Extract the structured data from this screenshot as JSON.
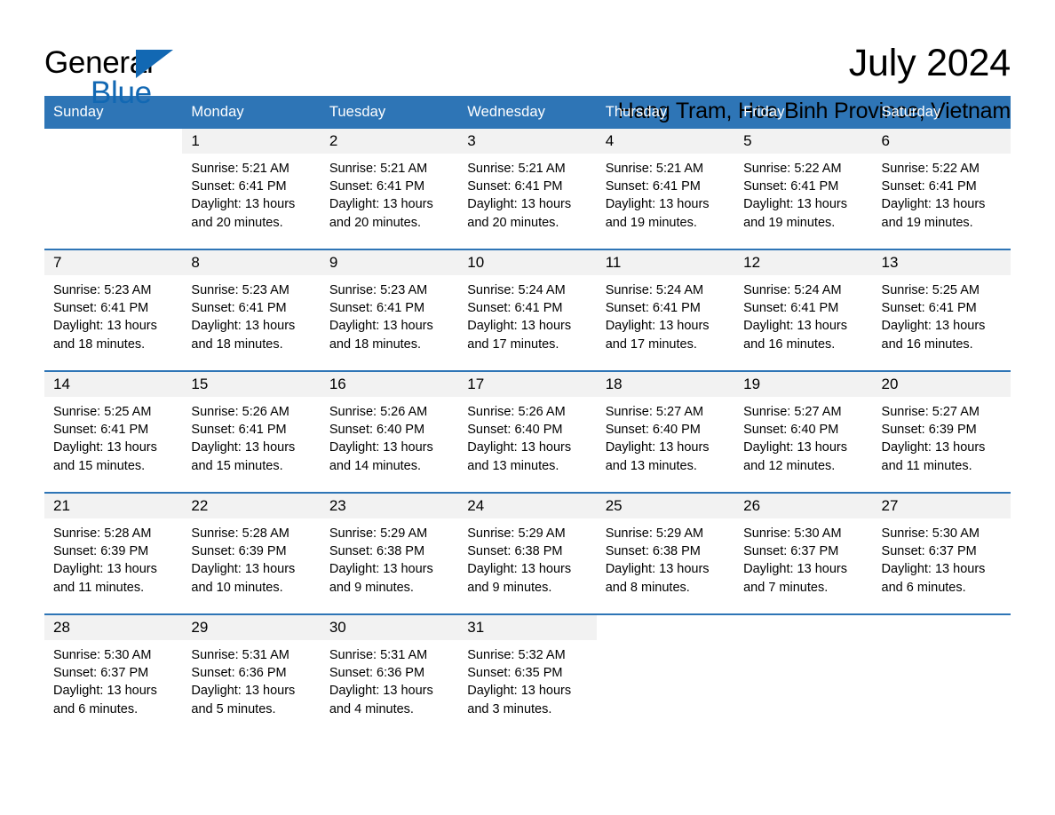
{
  "brand": {
    "name_part1": "General",
    "name_part2": "Blue",
    "logo_icon": "triangle-flag-icon"
  },
  "header": {
    "title": "July 2024",
    "location": "Hang Tram, Hoa Binh Province, Vietnam"
  },
  "colors": {
    "header_blue": "#2e75b6",
    "brand_blue": "#1268b3",
    "day_band_gray": "#f2f2f2",
    "text_black": "#000000"
  },
  "weekdays": [
    "Sunday",
    "Monday",
    "Tuesday",
    "Wednesday",
    "Thursday",
    "Friday",
    "Saturday"
  ],
  "weeks": [
    [
      {
        "day": "",
        "blank": true,
        "sunrise": "",
        "sunset": "",
        "daylight1": "",
        "daylight2": ""
      },
      {
        "day": "1",
        "sunrise": "Sunrise: 5:21 AM",
        "sunset": "Sunset: 6:41 PM",
        "daylight1": "Daylight: 13 hours",
        "daylight2": "and 20 minutes."
      },
      {
        "day": "2",
        "sunrise": "Sunrise: 5:21 AM",
        "sunset": "Sunset: 6:41 PM",
        "daylight1": "Daylight: 13 hours",
        "daylight2": "and 20 minutes."
      },
      {
        "day": "3",
        "sunrise": "Sunrise: 5:21 AM",
        "sunset": "Sunset: 6:41 PM",
        "daylight1": "Daylight: 13 hours",
        "daylight2": "and 20 minutes."
      },
      {
        "day": "4",
        "sunrise": "Sunrise: 5:21 AM",
        "sunset": "Sunset: 6:41 PM",
        "daylight1": "Daylight: 13 hours",
        "daylight2": "and 19 minutes."
      },
      {
        "day": "5",
        "sunrise": "Sunrise: 5:22 AM",
        "sunset": "Sunset: 6:41 PM",
        "daylight1": "Daylight: 13 hours",
        "daylight2": "and 19 minutes."
      },
      {
        "day": "6",
        "sunrise": "Sunrise: 5:22 AM",
        "sunset": "Sunset: 6:41 PM",
        "daylight1": "Daylight: 13 hours",
        "daylight2": "and 19 minutes."
      }
    ],
    [
      {
        "day": "7",
        "sunrise": "Sunrise: 5:23 AM",
        "sunset": "Sunset: 6:41 PM",
        "daylight1": "Daylight: 13 hours",
        "daylight2": "and 18 minutes."
      },
      {
        "day": "8",
        "sunrise": "Sunrise: 5:23 AM",
        "sunset": "Sunset: 6:41 PM",
        "daylight1": "Daylight: 13 hours",
        "daylight2": "and 18 minutes."
      },
      {
        "day": "9",
        "sunrise": "Sunrise: 5:23 AM",
        "sunset": "Sunset: 6:41 PM",
        "daylight1": "Daylight: 13 hours",
        "daylight2": "and 18 minutes."
      },
      {
        "day": "10",
        "sunrise": "Sunrise: 5:24 AM",
        "sunset": "Sunset: 6:41 PM",
        "daylight1": "Daylight: 13 hours",
        "daylight2": "and 17 minutes."
      },
      {
        "day": "11",
        "sunrise": "Sunrise: 5:24 AM",
        "sunset": "Sunset: 6:41 PM",
        "daylight1": "Daylight: 13 hours",
        "daylight2": "and 17 minutes."
      },
      {
        "day": "12",
        "sunrise": "Sunrise: 5:24 AM",
        "sunset": "Sunset: 6:41 PM",
        "daylight1": "Daylight: 13 hours",
        "daylight2": "and 16 minutes."
      },
      {
        "day": "13",
        "sunrise": "Sunrise: 5:25 AM",
        "sunset": "Sunset: 6:41 PM",
        "daylight1": "Daylight: 13 hours",
        "daylight2": "and 16 minutes."
      }
    ],
    [
      {
        "day": "14",
        "sunrise": "Sunrise: 5:25 AM",
        "sunset": "Sunset: 6:41 PM",
        "daylight1": "Daylight: 13 hours",
        "daylight2": "and 15 minutes."
      },
      {
        "day": "15",
        "sunrise": "Sunrise: 5:26 AM",
        "sunset": "Sunset: 6:41 PM",
        "daylight1": "Daylight: 13 hours",
        "daylight2": "and 15 minutes."
      },
      {
        "day": "16",
        "sunrise": "Sunrise: 5:26 AM",
        "sunset": "Sunset: 6:40 PM",
        "daylight1": "Daylight: 13 hours",
        "daylight2": "and 14 minutes."
      },
      {
        "day": "17",
        "sunrise": "Sunrise: 5:26 AM",
        "sunset": "Sunset: 6:40 PM",
        "daylight1": "Daylight: 13 hours",
        "daylight2": "and 13 minutes."
      },
      {
        "day": "18",
        "sunrise": "Sunrise: 5:27 AM",
        "sunset": "Sunset: 6:40 PM",
        "daylight1": "Daylight: 13 hours",
        "daylight2": "and 13 minutes."
      },
      {
        "day": "19",
        "sunrise": "Sunrise: 5:27 AM",
        "sunset": "Sunset: 6:40 PM",
        "daylight1": "Daylight: 13 hours",
        "daylight2": "and 12 minutes."
      },
      {
        "day": "20",
        "sunrise": "Sunrise: 5:27 AM",
        "sunset": "Sunset: 6:39 PM",
        "daylight1": "Daylight: 13 hours",
        "daylight2": "and 11 minutes."
      }
    ],
    [
      {
        "day": "21",
        "sunrise": "Sunrise: 5:28 AM",
        "sunset": "Sunset: 6:39 PM",
        "daylight1": "Daylight: 13 hours",
        "daylight2": "and 11 minutes."
      },
      {
        "day": "22",
        "sunrise": "Sunrise: 5:28 AM",
        "sunset": "Sunset: 6:39 PM",
        "daylight1": "Daylight: 13 hours",
        "daylight2": "and 10 minutes."
      },
      {
        "day": "23",
        "sunrise": "Sunrise: 5:29 AM",
        "sunset": "Sunset: 6:38 PM",
        "daylight1": "Daylight: 13 hours",
        "daylight2": "and 9 minutes."
      },
      {
        "day": "24",
        "sunrise": "Sunrise: 5:29 AM",
        "sunset": "Sunset: 6:38 PM",
        "daylight1": "Daylight: 13 hours",
        "daylight2": "and 9 minutes."
      },
      {
        "day": "25",
        "sunrise": "Sunrise: 5:29 AM",
        "sunset": "Sunset: 6:38 PM",
        "daylight1": "Daylight: 13 hours",
        "daylight2": "and 8 minutes."
      },
      {
        "day": "26",
        "sunrise": "Sunrise: 5:30 AM",
        "sunset": "Sunset: 6:37 PM",
        "daylight1": "Daylight: 13 hours",
        "daylight2": "and 7 minutes."
      },
      {
        "day": "27",
        "sunrise": "Sunrise: 5:30 AM",
        "sunset": "Sunset: 6:37 PM",
        "daylight1": "Daylight: 13 hours",
        "daylight2": "and 6 minutes."
      }
    ],
    [
      {
        "day": "28",
        "sunrise": "Sunrise: 5:30 AM",
        "sunset": "Sunset: 6:37 PM",
        "daylight1": "Daylight: 13 hours",
        "daylight2": "and 6 minutes."
      },
      {
        "day": "29",
        "sunrise": "Sunrise: 5:31 AM",
        "sunset": "Sunset: 6:36 PM",
        "daylight1": "Daylight: 13 hours",
        "daylight2": "and 5 minutes."
      },
      {
        "day": "30",
        "sunrise": "Sunrise: 5:31 AM",
        "sunset": "Sunset: 6:36 PM",
        "daylight1": "Daylight: 13 hours",
        "daylight2": "and 4 minutes."
      },
      {
        "day": "31",
        "sunrise": "Sunrise: 5:32 AM",
        "sunset": "Sunset: 6:35 PM",
        "daylight1": "Daylight: 13 hours",
        "daylight2": "and 3 minutes."
      },
      {
        "day": "",
        "blank": true,
        "sunrise": "",
        "sunset": "",
        "daylight1": "",
        "daylight2": ""
      },
      {
        "day": "",
        "blank": true,
        "sunrise": "",
        "sunset": "",
        "daylight1": "",
        "daylight2": ""
      },
      {
        "day": "",
        "blank": true,
        "sunrise": "",
        "sunset": "",
        "daylight1": "",
        "daylight2": ""
      }
    ]
  ]
}
